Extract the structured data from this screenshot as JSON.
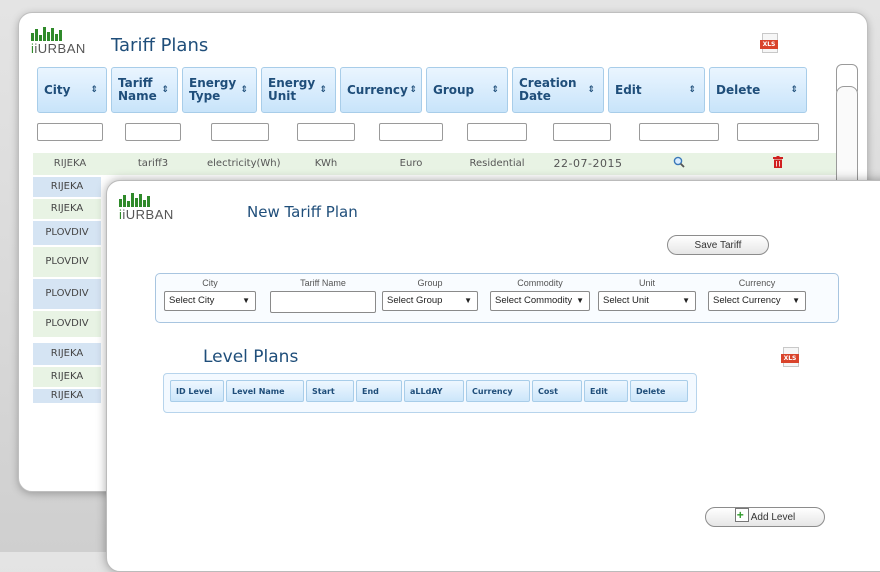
{
  "brand": "iURBAN",
  "back_window": {
    "title": "Tariff Plans",
    "xls": "XLS",
    "columns": [
      {
        "label": "City",
        "sort": "⇕"
      },
      {
        "label": "Tariff Name",
        "sort": "⇕"
      },
      {
        "label": "Energy Type",
        "sort": "⇕"
      },
      {
        "label": "Energy Unit",
        "sort": "⇕"
      },
      {
        "label": "Currency",
        "sort": "⇕"
      },
      {
        "label": "Group",
        "sort": "⇕"
      },
      {
        "label": "Creation Date",
        "sort": "⇕"
      },
      {
        "label": "Edit",
        "sort": "⇕"
      },
      {
        "label": "Delete",
        "sort": "⇕"
      }
    ],
    "first_row": {
      "city": "RIJEKA",
      "tariff": "tariff3",
      "energy_type": "electricity(Wh)",
      "unit": "KWh",
      "currency": "Euro",
      "group": "Residential",
      "date": "22-07-2015",
      "edit_icon": "magnifier-icon",
      "delete_icon": "trash-icon"
    },
    "city_rows": [
      "RIJEKA",
      "RIJEKA",
      "PLOVDIV",
      "PLOVDIV",
      "PLOVDIV",
      "PLOVDIV",
      "RIJEKA",
      "RIJEKA",
      "RIJEKA"
    ],
    "colors": {
      "row_green": "#e8f3e4",
      "row_blue": "#d5e4f3",
      "header_text": "#1f4e7a"
    }
  },
  "front_window": {
    "title": "New Tariff Plan",
    "save_label": "Save Tariff",
    "form": {
      "city_label": "City",
      "city_value": "Select City",
      "tariff_label": "Tariff Name",
      "tariff_value": "",
      "group_label": "Group",
      "group_value": "Select Group",
      "commodity_label": "Commodity",
      "commodity_value": "Select Commodity",
      "unit_label": "Unit",
      "unit_value": "Select Unit",
      "currency_label": "Currency",
      "currency_value": "Select Currency"
    },
    "level_title": "Level Plans",
    "level_columns": [
      "ID Level",
      "Level Name",
      "Start",
      "End",
      "aLLdAY",
      "Currency",
      "Cost",
      "Edit",
      "Delete"
    ],
    "add_level_label": "Add Level",
    "xls": "XLS"
  }
}
